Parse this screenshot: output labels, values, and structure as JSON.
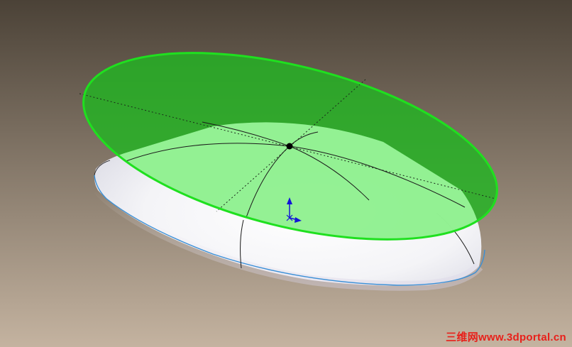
{
  "viewport": {
    "background_top": "#4b4237",
    "background_bottom": "#c4b3a0"
  },
  "model": {
    "body_color": "#ffffff",
    "silhouette_color": "#3a8fd6",
    "edge_color": "#1a1a1a"
  },
  "plane": {
    "fill_color": "#22b522",
    "border_color": "#1fe01f",
    "intersection_fill": "#9af59a"
  },
  "triad": {
    "icon": "coordinate-triad-icon",
    "axis_color": "#1414d8"
  },
  "watermark": {
    "text": "三维网www.3dportal.cn",
    "color": "#e8201a"
  }
}
